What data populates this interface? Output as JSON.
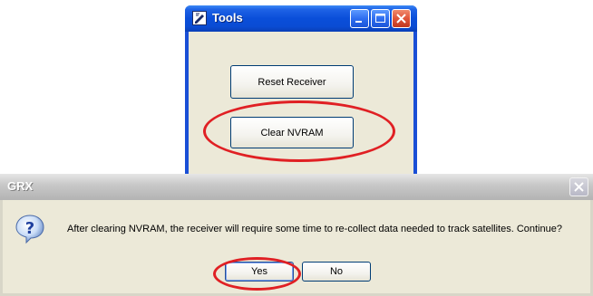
{
  "tools_window": {
    "title": "Tools",
    "buttons": {
      "reset_receiver": "Reset Receiver",
      "clear_nvram": "Clear NVRAM"
    },
    "caption_icons": [
      "minimize-icon",
      "maximize-icon",
      "close-icon"
    ]
  },
  "grx_dialog": {
    "title": "GRX",
    "icon": "question-icon",
    "message": "After clearing NVRAM, the receiver will require some time to re-collect data needed to track satellites. Continue?",
    "buttons": {
      "yes": "Yes",
      "no": "No"
    }
  },
  "colors": {
    "xp_titlebar_blue": "#0a4ed9",
    "dialog_face": "#ece9d8",
    "highlight_red": "#e02024"
  }
}
